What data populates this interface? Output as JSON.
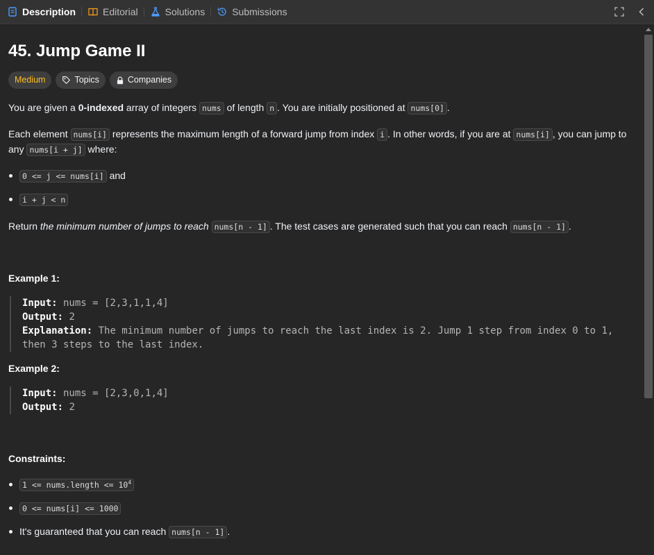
{
  "tabs": [
    {
      "label": "Description",
      "icon": "description-icon"
    },
    {
      "label": "Editorial",
      "icon": "book-icon"
    },
    {
      "label": "Solutions",
      "icon": "flask-icon"
    },
    {
      "label": "Submissions",
      "icon": "history-icon"
    }
  ],
  "problem": {
    "title": "45. Jump Game II",
    "tags": {
      "difficulty": "Medium",
      "topics": "Topics",
      "companies": "Companies"
    },
    "p1": {
      "t1": "You are given a ",
      "b1": "0-indexed",
      "t2": " array of integers ",
      "c1": "nums",
      "t3": " of length ",
      "c2": "n",
      "t4": ". You are initially positioned at ",
      "c3": "nums[0]",
      "t5": "."
    },
    "p2": {
      "t1": "Each element ",
      "c1": "nums[i]",
      "t2": " represents the maximum length of a forward jump from index ",
      "c2": "i",
      "t3": ". In other words, if you are at ",
      "c3": "nums[i]",
      "t4": ", you can jump to any ",
      "c4": "nums[i + j]",
      "t5": " where:"
    },
    "bullets": [
      {
        "code": "0 <= j <= nums[i]",
        "text": " and"
      },
      {
        "code": "i + j < n",
        "text": ""
      }
    ],
    "p3": {
      "t1": "Return ",
      "i1": "the minimum number of jumps to reach",
      "t2": " ",
      "c1": "nums[n - 1]",
      "t3": ". The test cases are generated such that you can reach ",
      "c2": "nums[n - 1]",
      "t4": "."
    },
    "example1": {
      "title": "Example 1:",
      "input_label": "Input:",
      "input": " nums = [2,3,1,1,4]",
      "output_label": "Output:",
      "output": " 2",
      "explanation_label": "Explanation:",
      "explanation": " The minimum number of jumps to reach the last index is 2. Jump 1 step from index 0 to 1, then 3 steps to the last index."
    },
    "example2": {
      "title": "Example 2:",
      "input_label": "Input:",
      "input": " nums = [2,3,0,1,4]",
      "output_label": "Output:",
      "output": " 2"
    },
    "constraints": {
      "title": "Constraints:",
      "c1_code": "1 <= nums.length <= 10",
      "c1_sup": "4",
      "c2_code": "0 <= nums[i] <= 1000",
      "c3_text": "It's guaranteed that you can reach ",
      "c3_code": "nums[n - 1]",
      "c3_end": "."
    }
  },
  "colors": {
    "accent": "#ffc01e",
    "tab_active": "#ffffff",
    "background": "#262626"
  }
}
